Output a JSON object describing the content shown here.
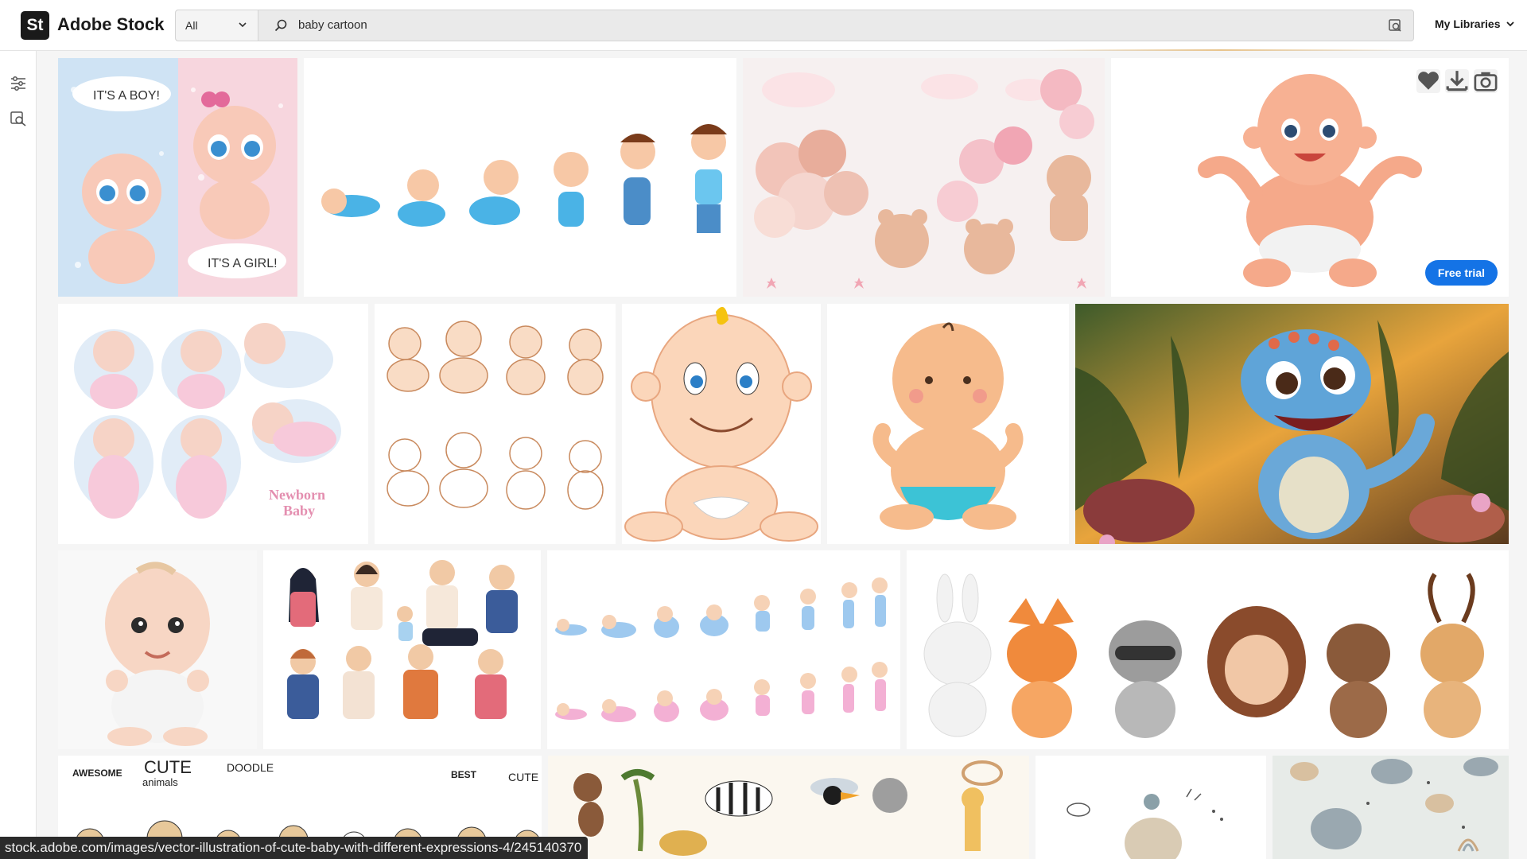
{
  "header": {
    "logo_mark": "St",
    "logo_text": "Adobe Stock",
    "filter_value": "All",
    "search_value": "baby cartoon",
    "my_libraries": "My Libraries"
  },
  "tile_hover": {
    "free_trial": "Free trial"
  },
  "tile_texts": {
    "boy": "IT'S A BOY!",
    "girl": "IT'S A GIRL!",
    "newborn_1": "Newborn",
    "newborn_2": "Baby",
    "cute": "CUTE",
    "animals": "animals",
    "awesome": "AWESOME",
    "doodle": "DOODLE",
    "best": "BEST",
    "cute2": "CUTE"
  },
  "status_url": "stock.adobe.com/images/vector-illustration-of-cute-baby-with-different-expressions-4/245140370",
  "icons": {
    "filter": "sliders-icon",
    "visual_search": "image-search-icon",
    "search": "search-icon",
    "heart": "heart-icon",
    "download": "download-icon",
    "camera": "camera-icon"
  },
  "colors": {
    "accent": "#1473e6",
    "header_bg": "#ffffff",
    "page_bg": "#f5f5f5"
  }
}
